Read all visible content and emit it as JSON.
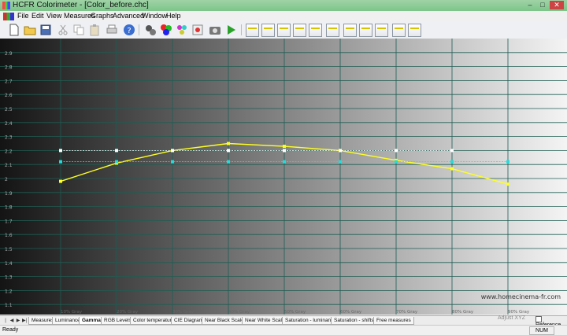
{
  "window": {
    "title": "HCFR Colorimeter - [Color_before.chc]",
    "buttons": {
      "minimize": "–",
      "maximize": "□",
      "close": "✕"
    }
  },
  "menu": [
    "File",
    "Edit",
    "View",
    "Measures",
    "Graphs",
    "Advanced",
    "Window",
    "Help"
  ],
  "toolbar": {
    "icons": [
      "new-file-icon",
      "open-folder-icon",
      "save-icon",
      "cut-icon",
      "copy-icon",
      "paste-icon",
      "print-icon",
      "help-icon",
      "sensor-icon",
      "rgb-generator-icon",
      "color-patches-icon",
      "target-icon",
      "camera-icon",
      "play-icon",
      "graph-measures-icon",
      "graph-luminance-icon",
      "graph-gamma-icon",
      "graph-rgb-levels-icon",
      "graph-color-temp-icon",
      "graph-cie-icon",
      "graph-near-black-icon",
      "graph-near-white-icon",
      "graph-saturation-icon",
      "graph-saturation-shifts-icon",
      "graph-free-measures-icon"
    ]
  },
  "chart_data": {
    "type": "line",
    "categories": [
      "10% Gray",
      "20% Gray",
      "30% Gray",
      "40% Gray",
      "50% Gray",
      "60% Gray",
      "70% Gray",
      "80% Gray",
      "90% Gray"
    ],
    "ylim": [
      1.0,
      3.0
    ],
    "yticks": [
      "2.9",
      "2.8",
      "2.7",
      "2.6",
      "2.5",
      "2.4",
      "2.3",
      "2.2",
      "2.1",
      "2",
      "1.9",
      "1.8",
      "1.7",
      "1.6",
      "1.5",
      "1.4",
      "1.3",
      "1.2",
      "1.1"
    ],
    "grid": true,
    "background": "black-to-white gradient",
    "series": [
      {
        "values": [
          1.98,
          2.11,
          2.2,
          2.25,
          2.23,
          2.2,
          2.13,
          2.07,
          1.96
        ],
        "color": "#ffff22"
      },
      {
        "values": [
          2.2,
          2.2,
          2.2,
          2.2,
          2.2,
          2.2,
          2.2,
          2.2
        ],
        "color": "#ffffff"
      },
      {
        "values": [
          2.12,
          2.12,
          2.12,
          2.12,
          2.12,
          2.12,
          2.12,
          2.12,
          2.12
        ],
        "color": "#22dddd"
      }
    ],
    "watermark": "www.homecinema-fr.com"
  },
  "tabs": [
    "Measures",
    "Luminance",
    "Gamma",
    "RGB Levels",
    "Color temperature",
    "CIE Diagram",
    "Near Black Scale",
    "Near White Scale",
    "Saturation - luminance",
    "Saturation - shifts",
    "Free measures"
  ],
  "active_tab": "Gamma",
  "status": {
    "left": "Ready",
    "num": "NUM",
    "adjust": "Adjust XYZ",
    "reference": "Reference"
  }
}
